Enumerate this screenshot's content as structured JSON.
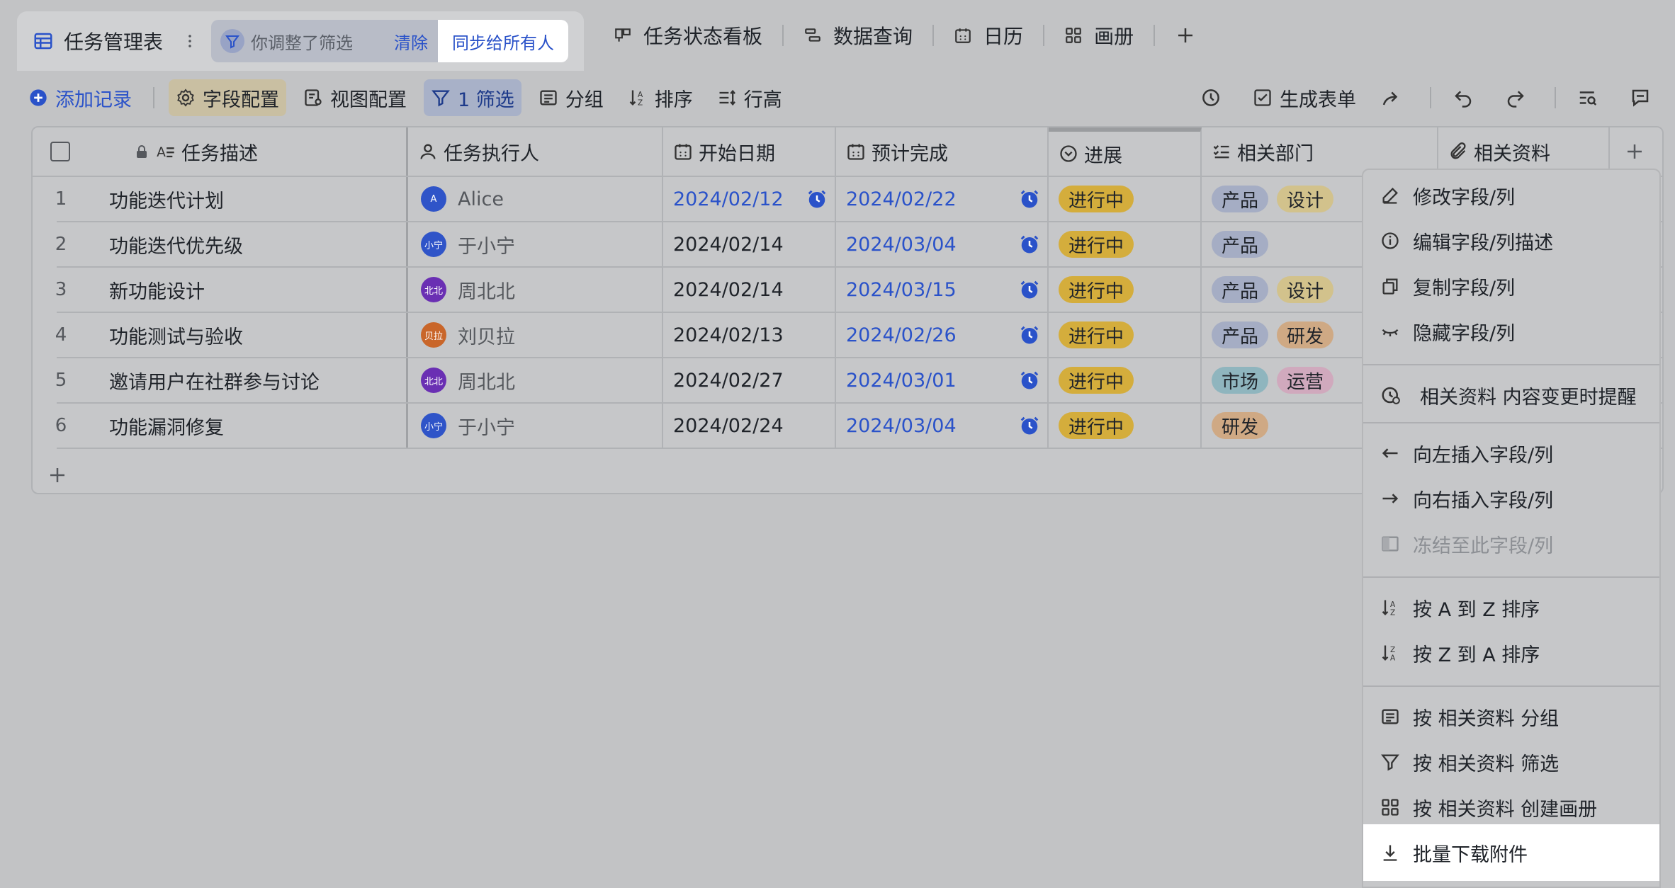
{
  "tabs": {
    "main": "任务管理表",
    "filter_hint": "你调整了筛选",
    "clear": "清除",
    "sync": "同步给所有人",
    "others": [
      "任务状态看板",
      "数据查询",
      "日历",
      "画册"
    ]
  },
  "toolbar": {
    "add_record": "添加记录",
    "field_config": "字段配置",
    "view_config": "视图配置",
    "filter": "1 筛选",
    "group": "分组",
    "sort": "排序",
    "row_height": "行高",
    "gen_form": "生成表单"
  },
  "columns": [
    "任务描述",
    "任务执行人",
    "开始日期",
    "预计完成",
    "进展",
    "相关部门",
    "相关资料"
  ],
  "rows": [
    {
      "n": "1",
      "task": "功能迭代计划",
      "owner": "Alice",
      "avatar_text": "A",
      "avatar_color": "#2f54c8",
      "start": "2024/02/12",
      "start_blue": true,
      "end": "2024/02/22",
      "status": "进行中",
      "depts": [
        [
          "产品",
          "b-prod"
        ],
        [
          "设计",
          "b-design"
        ]
      ]
    },
    {
      "n": "2",
      "task": "功能迭代优先级",
      "owner": "于小宁",
      "avatar_text": "小宁",
      "avatar_color": "#2f54c8",
      "start": "2024/02/14",
      "start_blue": false,
      "end": "2024/03/04",
      "status": "进行中",
      "depts": [
        [
          "产品",
          "b-prod"
        ]
      ]
    },
    {
      "n": "3",
      "task": "新功能设计",
      "owner": "周北北",
      "avatar_text": "北北",
      "avatar_color": "#6a2fb3",
      "start": "2024/02/14",
      "start_blue": false,
      "end": "2024/03/15",
      "status": "进行中",
      "depts": [
        [
          "产品",
          "b-prod"
        ],
        [
          "设计",
          "b-design"
        ]
      ]
    },
    {
      "n": "4",
      "task": "功能测试与验收",
      "owner": "刘贝拉",
      "avatar_text": "贝拉",
      "avatar_color": "#c9662a",
      "start": "2024/02/13",
      "start_blue": false,
      "end": "2024/02/26",
      "status": "进行中",
      "depts": [
        [
          "产品",
          "b-prod"
        ],
        [
          "研发",
          "b-dev"
        ]
      ]
    },
    {
      "n": "5",
      "task": "邀请用户在社群参与讨论",
      "owner": "周北北",
      "avatar_text": "北北",
      "avatar_color": "#6a2fb3",
      "start": "2024/02/27",
      "start_blue": false,
      "end": "2024/03/01",
      "status": "进行中",
      "depts": [
        [
          "市场",
          "b-market"
        ],
        [
          "运营",
          "b-ops"
        ]
      ]
    },
    {
      "n": "6",
      "task": "功能漏洞修复",
      "owner": "于小宁",
      "avatar_text": "小宁",
      "avatar_color": "#2f54c8",
      "start": "2024/02/24",
      "start_blue": false,
      "end": "2024/03/04",
      "status": "进行中",
      "depts": [
        [
          "研发",
          "b-dev"
        ]
      ]
    }
  ],
  "menu": {
    "edit_field": "修改字段/列",
    "edit_desc": "编辑字段/列描述",
    "copy_field": "复制字段/列",
    "hide_field": "隐藏字段/列",
    "notify": "相关资料 内容变更时提醒",
    "insert_left": "向左插入字段/列",
    "insert_right": "向右插入字段/列",
    "freeze": "冻结至此字段/列",
    "sort_az": "按 A 到 Z 排序",
    "sort_za": "按 Z 到 A 排序",
    "group_by": "按 相关资料 分组",
    "filter_by": "按 相关资料 筛选",
    "gallery_by": "按 相关资料 创建画册",
    "download": "批量下载附件"
  },
  "colors": {
    "accent": "#2a52c9",
    "status": "#d4ad3c"
  }
}
